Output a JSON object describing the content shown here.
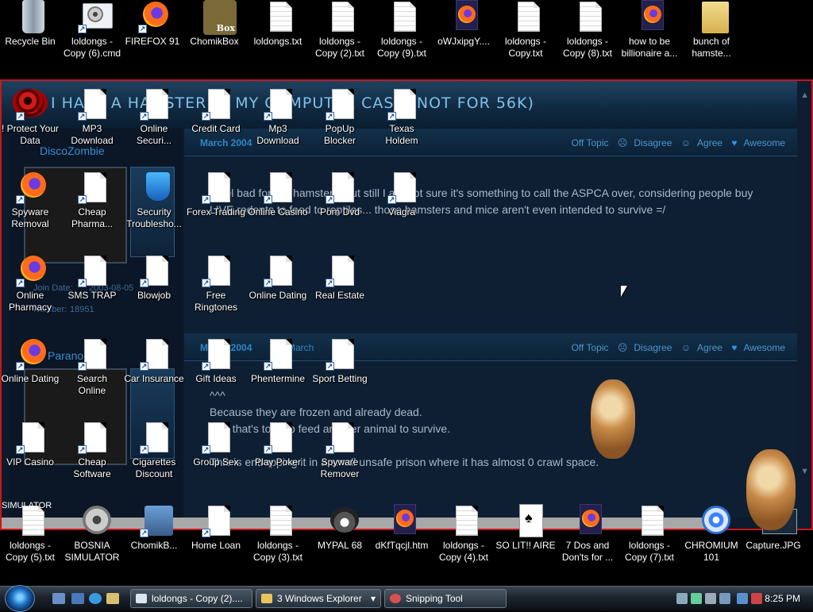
{
  "webpage": {
    "banner_title": "I HAVE A HAMSTER IN MY COMPUTER CASE (NOT FOR 56K)",
    "posts": [
      {
        "username": "DiscoZombie",
        "date": "March 2004",
        "actions": [
          "Off Topic",
          "Disagree",
          "Agree",
          "Awesome"
        ],
        "lines": [
          "I feel bad for the hamster... but still I am not sure it's something to call the ASPCA over, considering people buy",
          "LIVE rodents to feed to reptiles... those hamsters and mice aren't even intended to survive =/"
        ],
        "join_label": "Join Date:",
        "join_value": "2003-08-05",
        "number_label": "Number:",
        "number_value": "18951"
      },
      {
        "username": "Paranoia2",
        "date": "March 2004",
        "date_suffix": "d March",
        "actions": [
          "Off Topic",
          "Disagree",
          "Agree",
          "Awesome"
        ],
        "lines": [
          "^^^",
          "Because they are frozen and already dead.",
          "And that's to help feed another animal to survive.",
          "This is entrapping it in a small unsafe prison where it has almost 0 crawl space."
        ]
      }
    ],
    "simulator_text": "SIMULATOR"
  },
  "desktop_icons": {
    "top_row": [
      {
        "label": "Recycle Bin",
        "type": "recycle"
      },
      {
        "label": "loldongs - Copy (6).cmd",
        "type": "cmd"
      },
      {
        "label": "FIREFOX 91",
        "type": "firefox"
      },
      {
        "label": "ChomikBox",
        "type": "box"
      },
      {
        "label": "loldongs.txt",
        "type": "txt"
      },
      {
        "label": "loldongs - Copy (2).txt",
        "type": "txt"
      },
      {
        "label": "loldongs - Copy (9).txt",
        "type": "txt"
      },
      {
        "label": "oWJxipgY....",
        "type": "firefox-doc"
      },
      {
        "label": "loldongs - Copy.txt",
        "type": "txt"
      },
      {
        "label": "loldongs - Copy (8).txt",
        "type": "txt"
      },
      {
        "label": "how to be billionaire a...",
        "type": "firefox-doc"
      },
      {
        "label": "bunch of hamste...",
        "type": "folder"
      }
    ],
    "overlay": [
      {
        "label": "! Protect Your Data",
        "type": "eye"
      },
      {
        "label": "MP3 Download",
        "type": "doc"
      },
      {
        "label": "Online Securi...",
        "type": "doc"
      },
      {
        "label": "Credit Card",
        "type": "doc"
      },
      {
        "label": "Mp3 Download",
        "type": "doc"
      },
      {
        "label": "PopUp Blocker",
        "type": "doc"
      },
      {
        "label": "Texas Holdem",
        "type": "doc"
      },
      {
        "label": "Spyware Removal",
        "type": "firefox"
      },
      {
        "label": "Cheap Pharma...",
        "type": "doc"
      },
      {
        "label": "Security Troublesho...",
        "type": "shield"
      },
      {
        "label": "Forex Trading",
        "type": "doc"
      },
      {
        "label": "Online Casino",
        "type": "doc"
      },
      {
        "label": "Porn Dvd",
        "type": "doc"
      },
      {
        "label": "Viagra",
        "type": "doc"
      },
      {
        "label": "Online Pharmacy",
        "type": "firefox"
      },
      {
        "label": "SMS TRAP",
        "type": "doc"
      },
      {
        "label": "Blowjob",
        "type": "doc"
      },
      {
        "label": "Free Ringtones",
        "type": "doc"
      },
      {
        "label": "Online Dating",
        "type": "doc"
      },
      {
        "label": "Real Estate",
        "type": "doc"
      },
      {
        "label": "Online Dating",
        "type": "firefox"
      },
      {
        "label": "Search Online",
        "type": "doc"
      },
      {
        "label": "Car Insurance",
        "type": "doc"
      },
      {
        "label": "Gift Ideas",
        "type": "doc"
      },
      {
        "label": "Phentermine",
        "type": "doc"
      },
      {
        "label": "Sport Betting",
        "type": "doc"
      },
      {
        "label": "VIP Casino",
        "type": "doc"
      },
      {
        "label": "Cheap Software",
        "type": "doc"
      },
      {
        "label": "Cigarettes Discount",
        "type": "doc"
      },
      {
        "label": "Group Sex",
        "type": "doc"
      },
      {
        "label": "Play Poker",
        "type": "doc"
      },
      {
        "label": "Spyware Remover",
        "type": "doc"
      }
    ],
    "bottom_row": [
      {
        "label": "loldongs - Copy (5).txt",
        "type": "txt"
      },
      {
        "label": "BOSNIA SIMULATOR",
        "type": "gear"
      },
      {
        "label": "ChomikB...",
        "type": "pc"
      },
      {
        "label": "Home Loan",
        "type": "doc"
      },
      {
        "label": "loldongs - Copy (3).txt",
        "type": "txt"
      },
      {
        "label": "MYPAL 68",
        "type": "raccoon"
      },
      {
        "label": "dKfTqcjl.htm",
        "type": "firefox-doc"
      },
      {
        "label": "loldongs - Copy (4).txt",
        "type": "txt"
      },
      {
        "label": "SO LIT!! AIRE",
        "type": "cards"
      },
      {
        "label": "7 Dos and Don'ts for ...",
        "type": "firefox-doc"
      },
      {
        "label": "loldongs - Copy (7).txt",
        "type": "txt"
      },
      {
        "label": "CHROMIUM 101",
        "type": "chrome"
      },
      {
        "label": "Capture.JPG",
        "type": "capture"
      }
    ]
  },
  "taskbar": {
    "tasks": [
      {
        "label": "loldongs - Copy (2)...."
      },
      {
        "label": "3 Windows Explorer"
      },
      {
        "label": "Snipping Tool"
      }
    ],
    "clock": "8:25 PM"
  }
}
